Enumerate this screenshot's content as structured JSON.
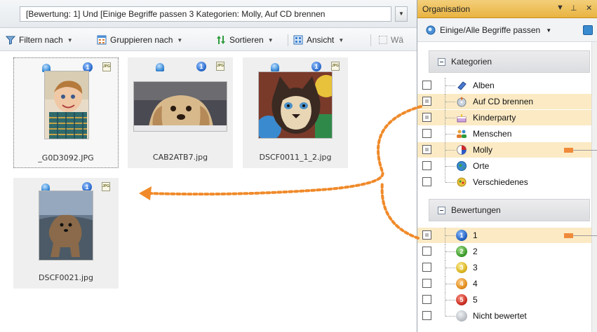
{
  "query": {
    "text": "[Bewertung: 1] Und [Einige Begriffe passen 3 Kategorien: Molly, Auf CD brennen"
  },
  "toolbar": {
    "filter": "Filtern nach",
    "group": "Gruppieren nach",
    "sort": "Sortieren",
    "view": "Ansicht",
    "more": "Wä"
  },
  "thumbnails": [
    {
      "caption": "_G0D3092.JPG",
      "rating": "1",
      "format": "JPG"
    },
    {
      "caption": "CAB2ATB7.jpg",
      "rating": "1",
      "format": "JPG"
    },
    {
      "caption": "DSCF0011_1_2.jpg",
      "rating": "1",
      "format": "JPG"
    },
    {
      "caption": "DSCF0021.jpg",
      "rating": "1",
      "format": "JPG"
    }
  ],
  "organizer": {
    "title": "Organisation",
    "filter_mode": "Einige/Alle Begriffe passen",
    "categories_header": "Kategorien",
    "categories": [
      {
        "label": "Alben",
        "icon": "album-icon",
        "state": "unchecked",
        "highlighted": false
      },
      {
        "label": "Auf CD brennen",
        "icon": "burn-cd-icon",
        "state": "partial",
        "highlighted": true
      },
      {
        "label": "Kinderparty",
        "icon": "cake-icon",
        "state": "partial",
        "highlighted": true
      },
      {
        "label": "Menschen",
        "icon": "people-icon",
        "state": "unchecked",
        "highlighted": false
      },
      {
        "label": "Molly",
        "icon": "molly-icon",
        "state": "partial",
        "highlighted": true
      },
      {
        "label": "Orte",
        "icon": "globe-icon",
        "state": "unchecked",
        "highlighted": false
      },
      {
        "label": "Verschiedenes",
        "icon": "misc-icon",
        "state": "unchecked",
        "highlighted": false
      }
    ],
    "ratings_header": "Bewertungen",
    "ratings": [
      {
        "label": "1",
        "badge": "1",
        "color": "#1f5fbf",
        "state": "partial",
        "highlighted": true
      },
      {
        "label": "2",
        "badge": "2",
        "color": "#3a9a2a",
        "state": "unchecked",
        "highlighted": false
      },
      {
        "label": "3",
        "badge": "3",
        "color": "#d8b21a",
        "state": "unchecked",
        "highlighted": false
      },
      {
        "label": "4",
        "badge": "4",
        "color": "#e08a1a",
        "state": "unchecked",
        "highlighted": false
      },
      {
        "label": "5",
        "badge": "5",
        "color": "#c8281e",
        "state": "unchecked",
        "highlighted": false
      },
      {
        "label": "Nicht bewertet",
        "badge": "",
        "color": "#b9bec4",
        "state": "unchecked",
        "highlighted": false
      }
    ]
  },
  "colors": {
    "accent": "#ef8a3a",
    "title_bar": "#e9b341",
    "highlight_row": "#fbeac4"
  }
}
